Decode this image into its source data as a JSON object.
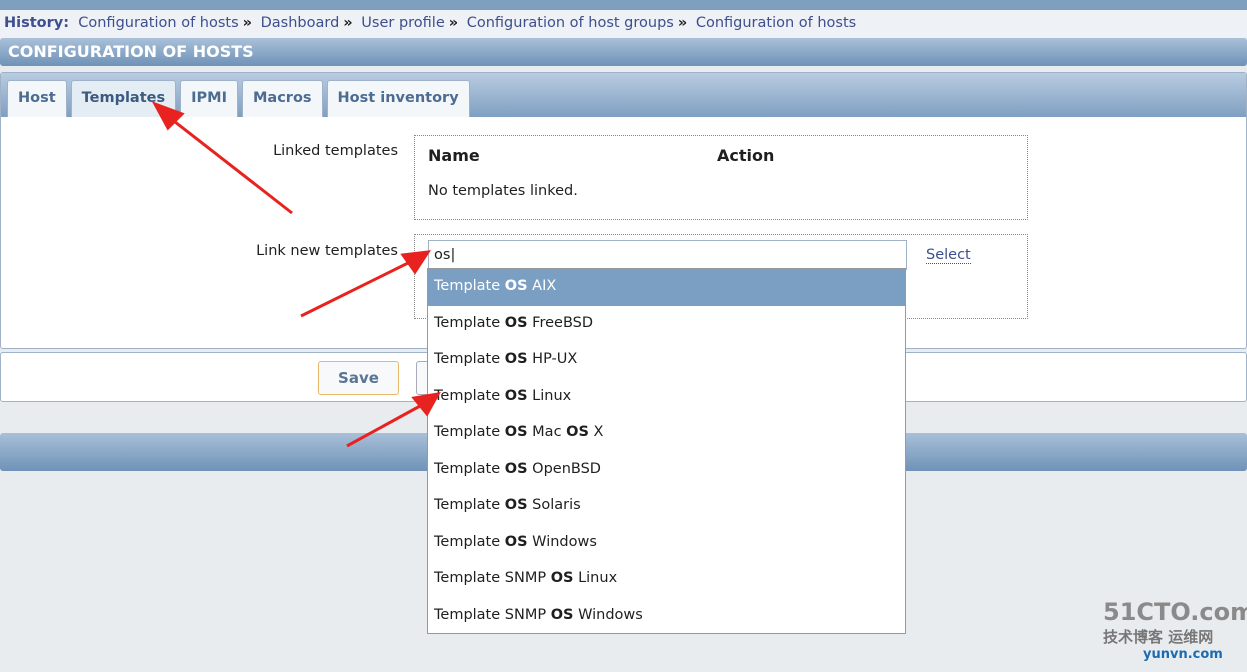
{
  "history": {
    "label": "History:",
    "items": [
      "Configuration of hosts",
      "Dashboard",
      "User profile",
      "Configuration of host groups",
      "Configuration of hosts"
    ],
    "separator": "»"
  },
  "header": {
    "title": "CONFIGURATION OF HOSTS"
  },
  "tabs": [
    {
      "label": "Host"
    },
    {
      "label": "Templates",
      "active": true
    },
    {
      "label": "IPMI"
    },
    {
      "label": "Macros"
    },
    {
      "label": "Host inventory"
    }
  ],
  "linked": {
    "label": "Linked templates",
    "col_name": "Name",
    "col_action": "Action",
    "empty": "No templates linked."
  },
  "link_new": {
    "label": "Link new templates",
    "input_value": "os",
    "select_label": "Select"
  },
  "dropdown": {
    "items": [
      {
        "pre": "Template ",
        "b1": "OS",
        "mid": " AIX",
        "b2": "",
        "post": ""
      },
      {
        "pre": "Template ",
        "b1": "OS",
        "mid": " FreeBSD",
        "b2": "",
        "post": ""
      },
      {
        "pre": "Template ",
        "b1": "OS",
        "mid": " HP-UX",
        "b2": "",
        "post": ""
      },
      {
        "pre": "Template ",
        "b1": "OS",
        "mid": " Linux",
        "b2": "",
        "post": ""
      },
      {
        "pre": "Template ",
        "b1": "OS",
        "mid": " Mac ",
        "b2": "OS",
        "post": " X"
      },
      {
        "pre": "Template ",
        "b1": "OS",
        "mid": " OpenBSD",
        "b2": "",
        "post": ""
      },
      {
        "pre": "Template ",
        "b1": "OS",
        "mid": " Solaris",
        "b2": "",
        "post": ""
      },
      {
        "pre": "Template ",
        "b1": "OS",
        "mid": " Windows",
        "b2": "",
        "post": ""
      },
      {
        "pre": "Template SNMP ",
        "b1": "OS",
        "mid": " Linux",
        "b2": "",
        "post": ""
      },
      {
        "pre": "Template SNMP ",
        "b1": "OS",
        "mid": " Windows",
        "b2": "",
        "post": ""
      }
    ],
    "highlighted_index": 0
  },
  "buttons": {
    "save": "Save"
  },
  "watermark": {
    "line1": "51CTO.com",
    "line2": "技术博客",
    "line3": "运维网",
    "line4": "yunvn.com"
  },
  "colors": {
    "header": "#7f9fc2",
    "highlight": "#7b9fc3",
    "arrow": "#e8231f"
  }
}
